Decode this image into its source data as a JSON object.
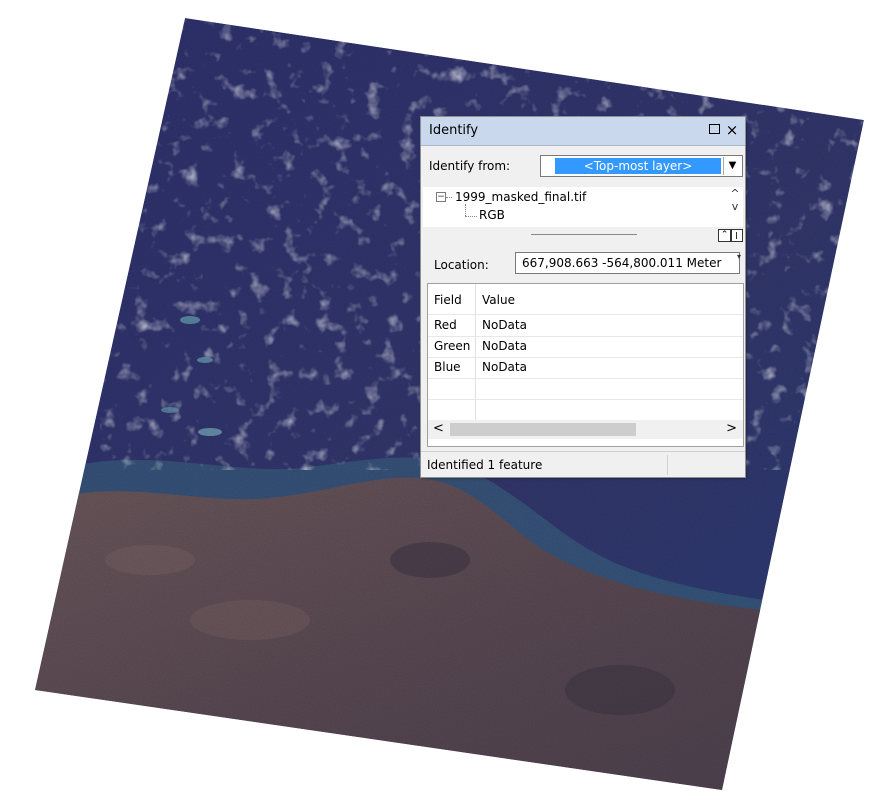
{
  "window": {
    "title": "Identify",
    "maximize_icon": "square-icon",
    "close_label": "×"
  },
  "identify_from": {
    "label": "Identify from:",
    "selected": "<Top-most layer>"
  },
  "tree": {
    "root": "1999_masked_final.tif",
    "child": "RGB"
  },
  "location": {
    "label": "Location:",
    "value": "667,908.663  -564,800.011 Meter"
  },
  "grid": {
    "headers": {
      "field": "Field",
      "value": "Value"
    },
    "rows": [
      {
        "field": "Red",
        "value": "NoData"
      },
      {
        "field": "Green",
        "value": "NoData"
      },
      {
        "field": "Blue",
        "value": "NoData"
      }
    ]
  },
  "status": {
    "text": "Identified 1 feature"
  },
  "colors": {
    "ocean": "#34366e",
    "land": "#5a4b52",
    "titlebar": "#c9d8ec",
    "selection": "#3399ff"
  }
}
